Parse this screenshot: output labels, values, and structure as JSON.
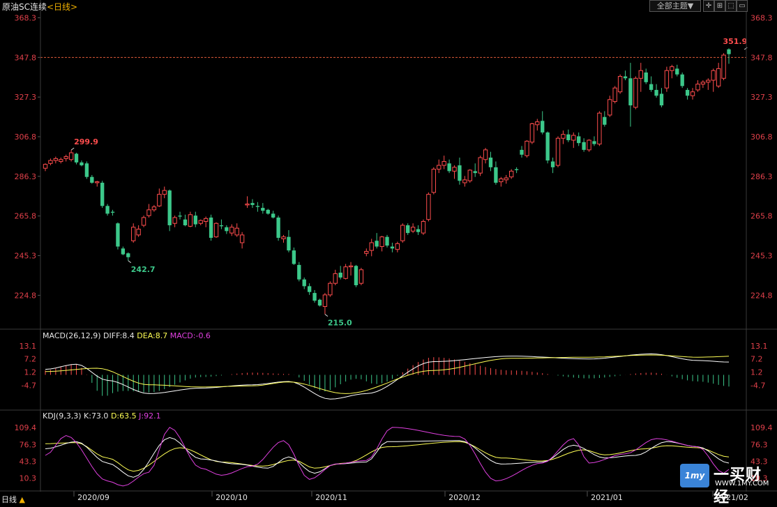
{
  "header": {
    "symbol": "原油SC连续",
    "timeframe": "<日线>",
    "theme_button": "全部主题▼",
    "tools": [
      "✛",
      "⊞",
      "⬚",
      "▭"
    ]
  },
  "bottom_bar": {
    "timeframe": "日线",
    "arrow": "▲"
  },
  "logo": {
    "box": "1my",
    "cn": "一买财经",
    "url": "WWW.1MY.COM",
    "color": "#3a84d8"
  },
  "colors": {
    "up": "#ff4d4d",
    "down": "#3cc88a",
    "axis": "#e0404a",
    "diff": "#ffffff",
    "dea": "#ffff55",
    "j": "#e040e0",
    "ref_line": "#e05a3a",
    "grid": "#333333"
  },
  "chart_data": [
    {
      "type": "candlestick",
      "title": "原油SC连续<日线>",
      "y_ticks": [
        "368.3",
        "347.8",
        "327.3",
        "306.8",
        "286.3",
        "265.8",
        "245.3",
        "224.8"
      ],
      "ylim": [
        208.0,
        371.0
      ],
      "reference_line": {
        "value": 347.8,
        "label": "347.8"
      },
      "x_labels": [
        "2020/09",
        "2020/10",
        "2020/11",
        "2020/12",
        "2021/01",
        "2021/02"
      ],
      "annotations": [
        {
          "text": "299.9",
          "value": 299.9,
          "index": 5,
          "kind": "high"
        },
        {
          "text": "242.7",
          "value": 242.7,
          "index": 16,
          "kind": "low"
        },
        {
          "text": "215.0",
          "value": 215.0,
          "index": 54,
          "kind": "low"
        },
        {
          "text": "351.9",
          "value": 351.9,
          "index": 135,
          "kind": "high"
        }
      ],
      "ohlc": [
        [
          290.5,
          293.0,
          289.0,
          292.5
        ],
        [
          293.0,
          295.5,
          292.0,
          294.5
        ],
        [
          294.5,
          296.5,
          293.0,
          295.5
        ],
        [
          294.0,
          296.0,
          293.0,
          295.0
        ],
        [
          295.5,
          297.5,
          294.0,
          296.5
        ],
        [
          295.0,
          299.9,
          294.0,
          298.5
        ],
        [
          298.0,
          298.5,
          292.5,
          293.5
        ],
        [
          293.5,
          294.5,
          291.5,
          292.0
        ],
        [
          293.0,
          294.0,
          285.0,
          286.0
        ],
        [
          286.0,
          287.0,
          282.5,
          283.0
        ],
        [
          283.0,
          284.0,
          281.0,
          283.5
        ],
        [
          283.0,
          284.0,
          270.0,
          271.0
        ],
        [
          271.0,
          272.0,
          266.0,
          267.0
        ],
        [
          268.0,
          269.0,
          266.0,
          267.5
        ],
        [
          262.0,
          262.5,
          248.5,
          250.0
        ],
        [
          249.0,
          250.0,
          245.5,
          246.0
        ],
        [
          246.5,
          247.0,
          242.7,
          244.5
        ],
        [
          253.0,
          262.0,
          252.0,
          260.0
        ],
        [
          256.0,
          261.0,
          255.0,
          259.0
        ],
        [
          261.0,
          266.0,
          260.0,
          265.0
        ],
        [
          266.0,
          272.0,
          265.0,
          269.0
        ],
        [
          269.0,
          271.5,
          268.0,
          270.5
        ],
        [
          271.0,
          280.0,
          270.5,
          277.0
        ],
        [
          277.0,
          281.0,
          275.0,
          279.0
        ],
        [
          279.0,
          279.5,
          258.0,
          261.0
        ],
        [
          262.0,
          266.0,
          260.0,
          265.0
        ],
        [
          266.0,
          268.0,
          264.0,
          265.5
        ],
        [
          264.0,
          266.5,
          260.5,
          261.0
        ],
        [
          260.5,
          268.0,
          260.0,
          266.5
        ],
        [
          266.0,
          268.0,
          260.0,
          261.5
        ],
        [
          262.0,
          264.0,
          261.0,
          263.5
        ],
        [
          263.0,
          265.5,
          260.0,
          264.5
        ],
        [
          265.0,
          266.5,
          253.0,
          254.5
        ],
        [
          255.0,
          262.5,
          254.5,
          262.0
        ],
        [
          261.0,
          264.0,
          259.0,
          260.5
        ],
        [
          260.0,
          261.0,
          256.5,
          258.0
        ],
        [
          257.0,
          261.5,
          255.5,
          260.0
        ],
        [
          256.0,
          262.0,
          255.0,
          259.5
        ],
        [
          252.0,
          257.5,
          249.0,
          256.0
        ],
        [
          271.5,
          276.0,
          270.0,
          272.0
        ],
        [
          272.5,
          274.5,
          270.0,
          271.5
        ],
        [
          271.0,
          273.0,
          268.0,
          270.5
        ],
        [
          270.0,
          272.5,
          267.0,
          268.5
        ],
        [
          269.0,
          269.5,
          266.5,
          267.0
        ],
        [
          267.0,
          268.5,
          264.5,
          265.0
        ],
        [
          265.0,
          266.0,
          253.0,
          254.5
        ],
        [
          254.0,
          256.0,
          252.0,
          255.0
        ],
        [
          255.0,
          258.5,
          247.0,
          248.0
        ],
        [
          248.0,
          249.5,
          240.5,
          241.0
        ],
        [
          240.5,
          242.0,
          232.0,
          233.0
        ],
        [
          233.0,
          234.0,
          228.0,
          229.5
        ],
        [
          229.5,
          231.0,
          225.0,
          226.5
        ],
        [
          226.0,
          227.5,
          221.0,
          222.0
        ],
        [
          222.5,
          223.0,
          219.0,
          219.5
        ],
        [
          219.0,
          226.0,
          215.0,
          225.0
        ],
        [
          225.0,
          232.0,
          224.0,
          231.0
        ],
        [
          231.0,
          238.0,
          230.0,
          236.0
        ],
        [
          236.5,
          240.0,
          233.0,
          234.0
        ],
        [
          233.5,
          241.0,
          233.0,
          239.5
        ],
        [
          239.5,
          242.0,
          235.0,
          240.0
        ],
        [
          240.0,
          240.5,
          229.0,
          230.0
        ],
        [
          231.0,
          239.0,
          230.0,
          238.0
        ],
        [
          246.5,
          249.0,
          245.0,
          247.5
        ],
        [
          248.0,
          254.0,
          245.0,
          252.0
        ],
        [
          253.0,
          257.0,
          249.0,
          250.0
        ],
        [
          250.0,
          255.5,
          247.5,
          255.0
        ],
        [
          255.0,
          256.0,
          249.5,
          250.5
        ],
        [
          250.0,
          252.0,
          247.0,
          249.0
        ],
        [
          248.5,
          252.5,
          247.0,
          251.5
        ],
        [
          253.0,
          262.0,
          252.0,
          261.0
        ],
        [
          261.0,
          262.0,
          256.0,
          257.0
        ],
        [
          258.0,
          262.0,
          257.0,
          260.0
        ],
        [
          259.0,
          261.0,
          256.0,
          257.5
        ],
        [
          257.0,
          264.0,
          256.0,
          263.0
        ],
        [
          264.0,
          278.0,
          263.0,
          277.0
        ],
        [
          278.0,
          291.0,
          277.0,
          290.0
        ],
        [
          290.0,
          295.0,
          288.0,
          292.0
        ],
        [
          292.0,
          297.0,
          290.0,
          294.0
        ],
        [
          293.0,
          295.0,
          288.0,
          289.0
        ],
        [
          289.0,
          292.0,
          285.0,
          291.0
        ],
        [
          292.0,
          296.0,
          282.0,
          284.0
        ],
        [
          283.0,
          286.5,
          281.0,
          284.5
        ],
        [
          284.0,
          290.0,
          283.0,
          289.5
        ],
        [
          289.0,
          293.0,
          286.0,
          288.0
        ],
        [
          288.0,
          297.0,
          286.5,
          296.0
        ],
        [
          295.0,
          301.0,
          293.0,
          300.0
        ],
        [
          296.0,
          299.0,
          289.0,
          291.0
        ],
        [
          291.0,
          294.0,
          282.0,
          283.0
        ],
        [
          283.5,
          286.0,
          281.0,
          285.0
        ],
        [
          284.5,
          287.0,
          282.5,
          285.5
        ],
        [
          286.0,
          290.0,
          285.0,
          289.0
        ],
        [
          290.0,
          291.0,
          288.0,
          289.5
        ],
        [
          300.0,
          302.0,
          296.0,
          297.5
        ],
        [
          297.0,
          305.0,
          296.0,
          304.5
        ],
        [
          304.0,
          314.0,
          303.0,
          313.5
        ],
        [
          313.0,
          316.0,
          310.0,
          314.5
        ],
        [
          315.0,
          320.0,
          308.0,
          309.0
        ],
        [
          309.0,
          309.5,
          293.0,
          294.5
        ],
        [
          294.0,
          296.0,
          288.0,
          291.0
        ],
        [
          292.0,
          307.0,
          291.0,
          306.0
        ],
        [
          306.0,
          310.0,
          303.0,
          308.0
        ],
        [
          308.0,
          310.5,
          304.0,
          305.0
        ],
        [
          305.0,
          309.0,
          301.0,
          307.5
        ],
        [
          307.0,
          309.0,
          302.0,
          303.5
        ],
        [
          304.0,
          306.0,
          299.0,
          300.0
        ],
        [
          300.0,
          305.5,
          299.0,
          305.0
        ],
        [
          304.5,
          307.0,
          302.0,
          303.0
        ],
        [
          303.0,
          320.0,
          302.0,
          319.0
        ],
        [
          317.0,
          320.0,
          312.0,
          313.0
        ],
        [
          318.0,
          328.0,
          317.0,
          326.0
        ],
        [
          325.0,
          333.0,
          324.0,
          332.0
        ],
        [
          330.0,
          339.0,
          329.0,
          338.0
        ],
        [
          338.0,
          341.0,
          336.0,
          337.0
        ],
        [
          337.0,
          345.0,
          312.0,
          323.0
        ],
        [
          322.0,
          338.0,
          321.0,
          337.0
        ],
        [
          337.0,
          345.0,
          330.0,
          341.0
        ],
        [
          340.0,
          342.0,
          334.0,
          335.0
        ],
        [
          334.0,
          338.0,
          330.0,
          331.0
        ],
        [
          331.0,
          334.0,
          327.0,
          328.0
        ],
        [
          329.0,
          332.0,
          322.0,
          323.0
        ],
        [
          332.0,
          343.0,
          330.0,
          341.0
        ],
        [
          341.0,
          344.0,
          337.0,
          343.0
        ],
        [
          342.0,
          344.0,
          338.0,
          339.0
        ],
        [
          339.0,
          340.0,
          332.0,
          333.0
        ],
        [
          331.0,
          332.0,
          326.0,
          328.0
        ],
        [
          328.0,
          332.0,
          326.0,
          330.0
        ],
        [
          331.0,
          336.0,
          330.0,
          334.0
        ],
        [
          334.0,
          336.0,
          332.0,
          335.0
        ],
        [
          335.0,
          337.0,
          331.0,
          336.0
        ],
        [
          336.0,
          342.0,
          330.0,
          341.0
        ],
        [
          333.0,
          345.0,
          332.0,
          342.0
        ],
        [
          337.0,
          350.0,
          336.0,
          349.0
        ],
        [
          352.0,
          352.5,
          344.5,
          349.5
        ]
      ]
    },
    {
      "type": "bar+line",
      "title": "MACD(26,12,9)",
      "legend": [
        {
          "name": "DIFF",
          "value": "8.4",
          "color": "#ffffff"
        },
        {
          "name": "DEA",
          "value": "8.7",
          "color": "#ffff55"
        },
        {
          "name": "MACD",
          "value": "-0.6",
          "color": "#e040e0"
        }
      ],
      "y_ticks": [
        "13.1",
        "7.2",
        "1.2",
        "-4.7"
      ],
      "ylim": [
        -15.0,
        15.0
      ],
      "diff_anchors": [
        [
          0,
          2.5
        ],
        [
          6,
          4.8
        ],
        [
          12,
          -2.5
        ],
        [
          20,
          -8.5
        ],
        [
          30,
          -6.0
        ],
        [
          40,
          -4.5
        ],
        [
          47,
          -3.0
        ],
        [
          55,
          -11.0
        ],
        [
          62,
          -8.5
        ],
        [
          75,
          6.0
        ],
        [
          90,
          8.5
        ],
        [
          105,
          7.2
        ],
        [
          117,
          9.5
        ],
        [
          126,
          6.5
        ],
        [
          132,
          5.8
        ],
        [
          136,
          8.4
        ]
      ],
      "dea_anchors": [
        [
          0,
          1.5
        ],
        [
          10,
          3.0
        ],
        [
          20,
          -4.5
        ],
        [
          30,
          -5.5
        ],
        [
          40,
          -5.0
        ],
        [
          47,
          -3.2
        ],
        [
          58,
          -8.5
        ],
        [
          75,
          2.0
        ],
        [
          90,
          7.5
        ],
        [
          105,
          8.0
        ],
        [
          117,
          9.0
        ],
        [
          126,
          8.0
        ],
        [
          136,
          8.7
        ]
      ]
    },
    {
      "type": "line",
      "title": "KDJ(9,3,3)",
      "legend": [
        {
          "name": "K",
          "value": "73.0",
          "color": "#ffffff"
        },
        {
          "name": "D",
          "value": "63.5",
          "color": "#ffff55"
        },
        {
          "name": "J",
          "value": "92.1",
          "color": "#e040e0"
        }
      ],
      "y_ticks": [
        "109.4",
        "76.3",
        "43.3",
        "10.3"
      ],
      "ylim": [
        -12.0,
        122.0
      ],
      "k_anchors": [
        [
          0,
          68
        ],
        [
          6,
          82
        ],
        [
          12,
          40
        ],
        [
          17,
          12
        ],
        [
          24,
          90
        ],
        [
          30,
          48
        ],
        [
          37,
          38
        ],
        [
          43,
          30
        ],
        [
          47,
          52
        ],
        [
          52,
          20
        ],
        [
          56,
          38
        ],
        [
          62,
          42
        ],
        [
          66,
          82
        ],
        [
          80,
          84
        ],
        [
          88,
          38
        ],
        [
          96,
          42
        ],
        [
          102,
          75
        ],
        [
          108,
          50
        ],
        [
          114,
          55
        ],
        [
          120,
          82
        ],
        [
          126,
          72
        ],
        [
          132,
          40
        ],
        [
          136,
          73
        ]
      ],
      "d_anchors": [
        [
          0,
          78
        ],
        [
          6,
          80
        ],
        [
          12,
          50
        ],
        [
          17,
          24
        ],
        [
          26,
          70
        ],
        [
          34,
          42
        ],
        [
          42,
          34
        ],
        [
          48,
          46
        ],
        [
          52,
          30
        ],
        [
          58,
          40
        ],
        [
          66,
          72
        ],
        [
          80,
          82
        ],
        [
          88,
          50
        ],
        [
          96,
          44
        ],
        [
          104,
          66
        ],
        [
          108,
          56
        ],
        [
          116,
          68
        ],
        [
          120,
          74
        ],
        [
          126,
          70
        ],
        [
          132,
          52
        ],
        [
          136,
          63.5
        ]
      ],
      "j_anchors": [
        [
          0,
          55
        ],
        [
          4,
          94
        ],
        [
          12,
          5
        ],
        [
          15,
          -5
        ],
        [
          20,
          22
        ],
        [
          24,
          110
        ],
        [
          30,
          30
        ],
        [
          34,
          16
        ],
        [
          40,
          34
        ],
        [
          46,
          84
        ],
        [
          51,
          8
        ],
        [
          56,
          38
        ],
        [
          62,
          45
        ],
        [
          67,
          110
        ],
        [
          80,
          92
        ],
        [
          87,
          5
        ],
        [
          96,
          40
        ],
        [
          102,
          88
        ],
        [
          105,
          40
        ],
        [
          112,
          58
        ],
        [
          118,
          88
        ],
        [
          126,
          72
        ],
        [
          131,
          20
        ],
        [
          136,
          92.1
        ]
      ]
    }
  ]
}
